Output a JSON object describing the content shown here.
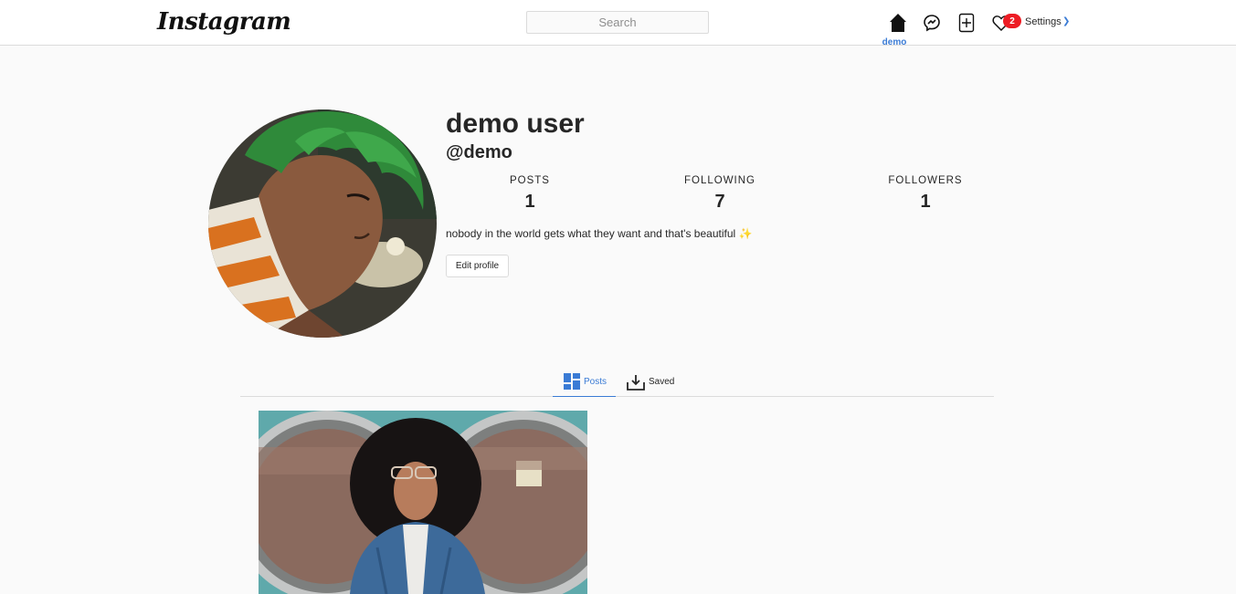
{
  "header": {
    "logo": "Instagram",
    "search_placeholder": "Search",
    "home_label": "demo",
    "notification_count": "2",
    "settings_label": "Settings",
    "icons": [
      "home-icon",
      "messenger-icon",
      "new-post-icon",
      "heart-icon",
      "chevron-down-icon"
    ],
    "accent_color": "#3a7bd5",
    "badge_color": "#ed1c24"
  },
  "profile": {
    "display_name": "demo user",
    "handle": "@demo",
    "stats": [
      {
        "label": "POSTS",
        "value": "1"
      },
      {
        "label": "FOLLOWING",
        "value": "7"
      },
      {
        "label": "FOLLOWERS",
        "value": "1"
      }
    ],
    "bio": "nobody in the world gets what they want and that's beautiful ✨",
    "edit_button": "Edit profile"
  },
  "tabs": [
    {
      "label": "Posts",
      "icon": "grid-icon",
      "active": true
    },
    {
      "label": "Saved",
      "icon": "download-icon",
      "active": false
    }
  ],
  "posts": [
    {
      "alt": "woman in denim jacket in front of washing machines"
    }
  ]
}
